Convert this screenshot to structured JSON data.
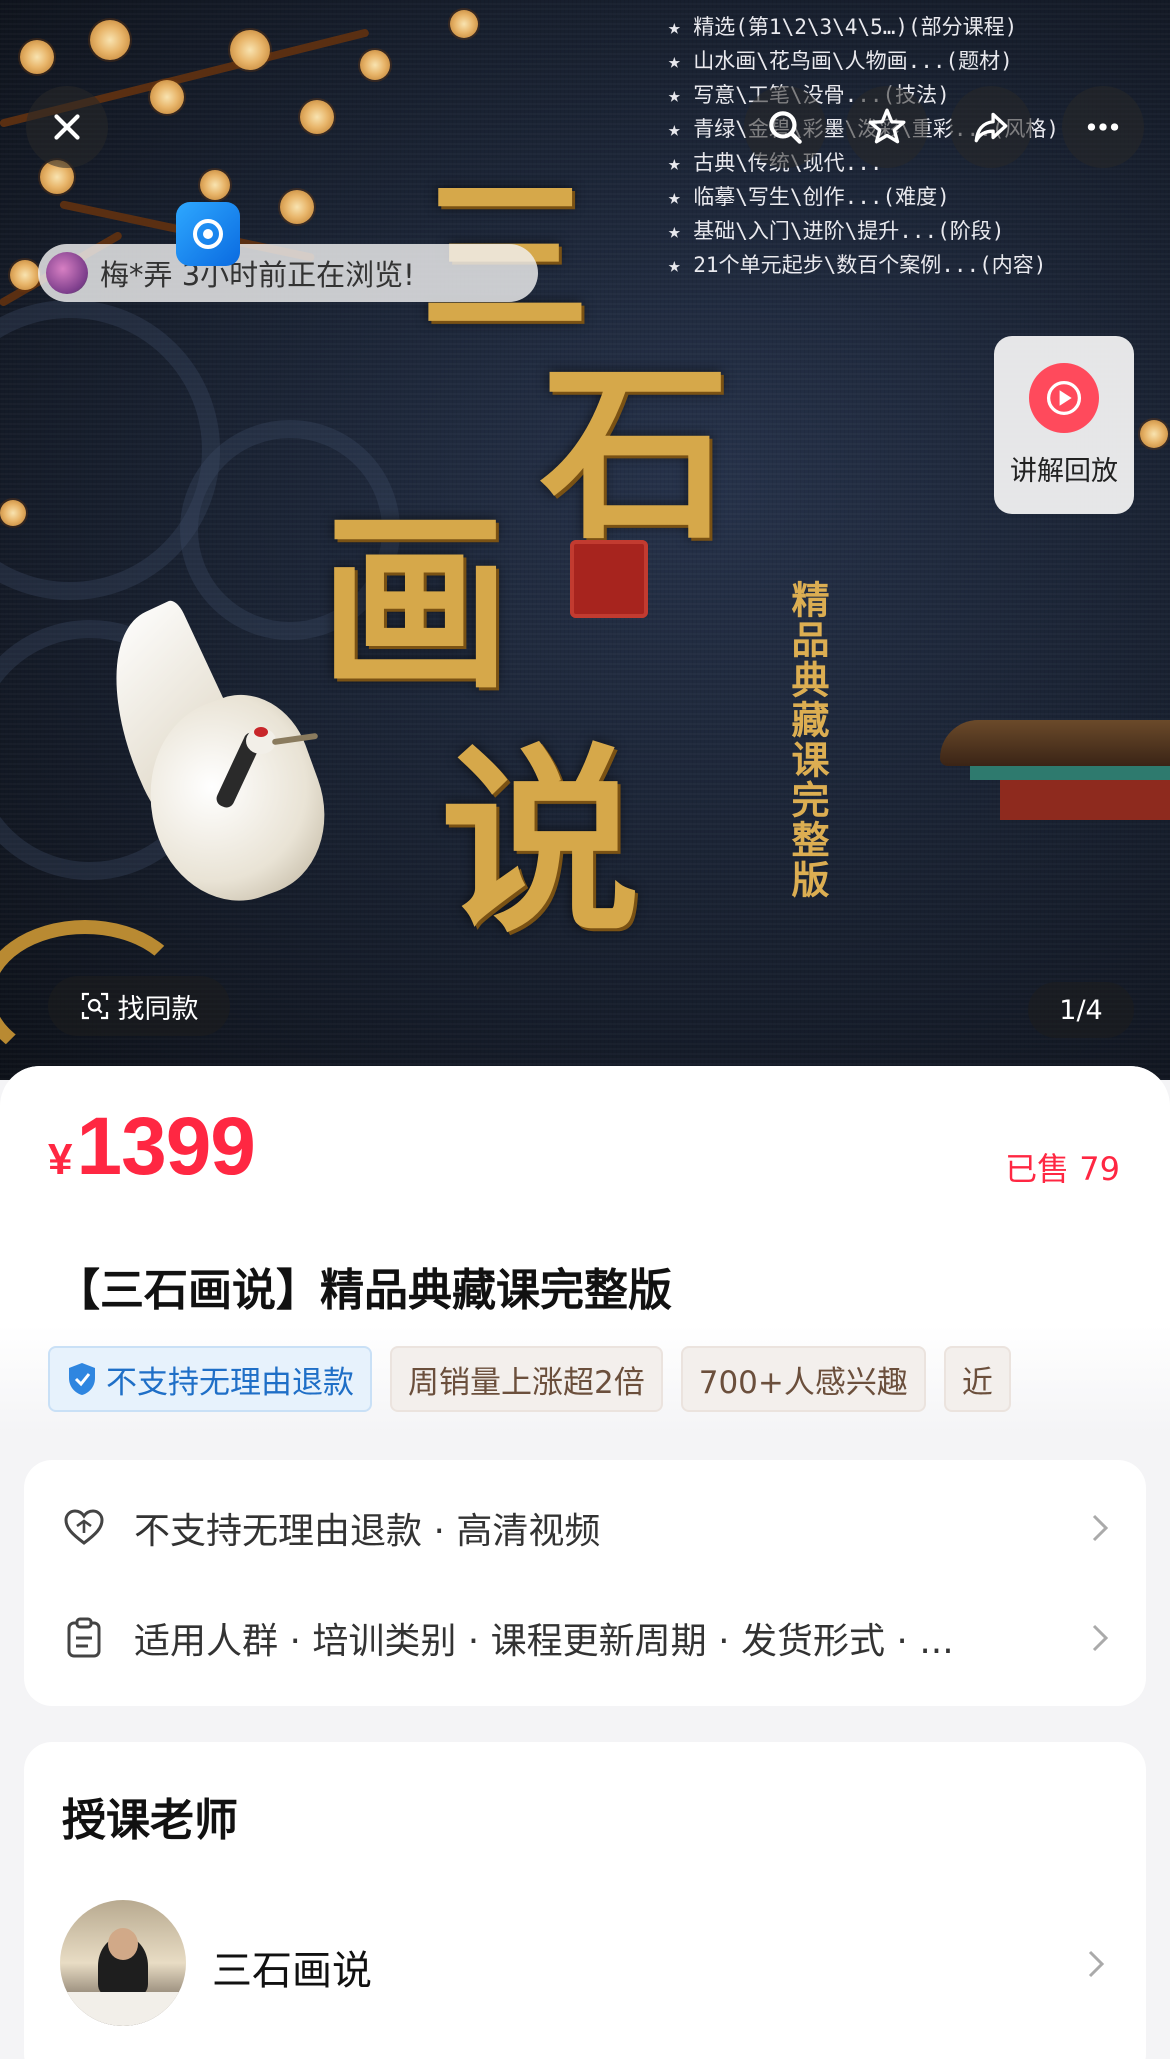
{
  "hero": {
    "feature_lines": [
      "★ 精选(第1\\2\\3\\4\\5…)(部分课程)",
      "★ 山水画\\花鸟画\\人物画...(题材)",
      "★ 写意\\工笔\\没骨...(技法)",
      "★ 青绿\\金碧\\彩墨\\泼彩\\重彩...(风格)",
      "★ 古典\\传统\\现代...",
      "★ 临摹\\写生\\创作...(难度)",
      "★ 基础\\入门\\进阶\\提升...(阶段)",
      "★ 21个单元起步\\数百个案例...(内容)"
    ],
    "calligraphy": [
      "三",
      "石",
      "画",
      "说"
    ],
    "vertical_subtitle": "精品典藏课完整版",
    "viewer_notice": "梅*弄 3小时前正在浏览!",
    "replay_label": "讲解回放",
    "find_same_label": "找同款",
    "page_indicator": "1/4"
  },
  "product": {
    "currency": "¥",
    "price": "1399",
    "sold": "已售 79",
    "title": "【三石画说】精品典藏课完整版",
    "tags": [
      {
        "label": "不支持无理由退款",
        "style": "blue"
      },
      {
        "label": "周销量上涨超2倍",
        "style": "plain"
      },
      {
        "label": "700+人感兴趣",
        "style": "plain"
      },
      {
        "label": "近",
        "style": "plain"
      }
    ]
  },
  "service_card": {
    "row1": "不支持无理由退款 · 高清视频",
    "row2": "适用人群 · 培训类别 · 课程更新周期 · 发货形式 · ..."
  },
  "teacher": {
    "section_title": "授课老师",
    "name": "三石画说"
  },
  "colors": {
    "price_red": "#ff2742",
    "gold": "#d6a84a",
    "hero_bg": "#18202f",
    "tag_blue": "#1f6fc7"
  }
}
